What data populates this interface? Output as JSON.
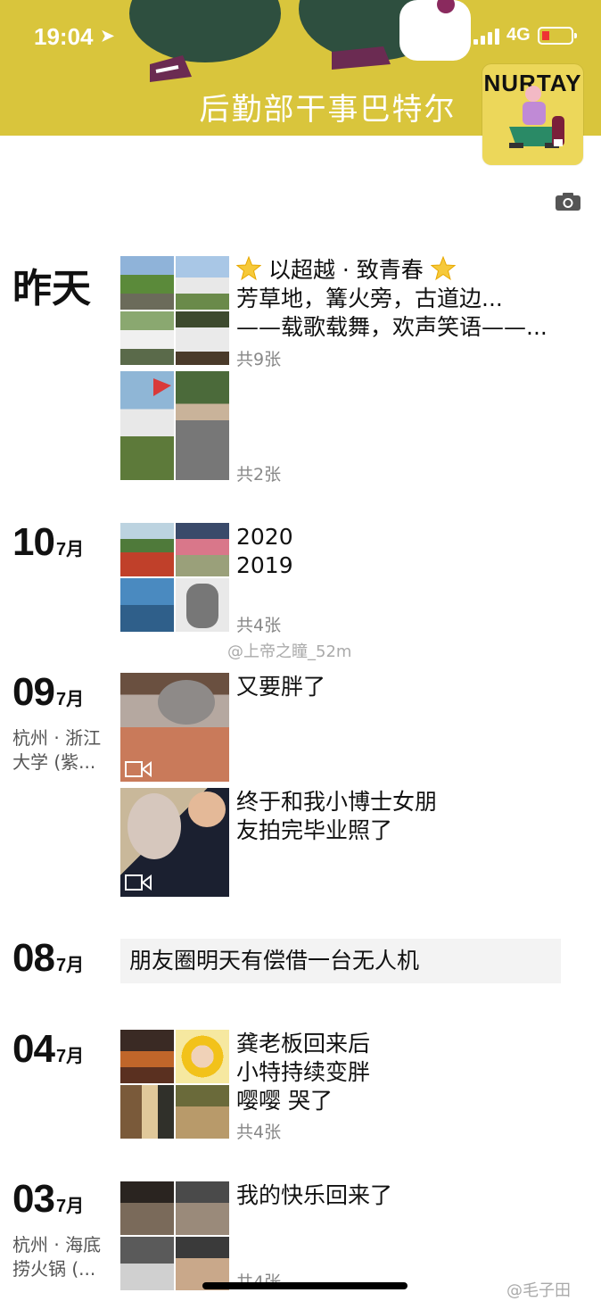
{
  "status_bar": {
    "time": "19:04",
    "location_symbol": "➤",
    "network": "4G"
  },
  "profile": {
    "name": "后勤部干事巴特尔",
    "avatar_text": "NURTAY"
  },
  "icons": {
    "camera": "camera-icon",
    "video": "video-icon",
    "star": "star-emoji-icon"
  },
  "posts": [
    {
      "day_label": "昨天",
      "lines": [
        "以超越 · 致青春",
        "芳草地，篝火旁，古道边...",
        "——载歌载舞，欢声笑语——..."
      ],
      "count": "共9张"
    },
    {
      "lines": [],
      "count": "共2张"
    },
    {
      "day": "10",
      "month": "7月",
      "lines": [
        "2020",
        "2019"
      ],
      "count": "共4张"
    },
    {
      "day": "09",
      "month": "7月",
      "place": [
        "杭州 · 浙江",
        "大学 (紫..."
      ],
      "lines": [
        "又要胖了"
      ]
    },
    {
      "lines": [
        "终于和我小博士女朋",
        "友拍完毕业照了"
      ]
    },
    {
      "day": "08",
      "month": "7月",
      "text_post": "朋友圈明天有偿借一台无人机"
    },
    {
      "day": "04",
      "month": "7月",
      "lines": [
        "龚老板回来后",
        "小特持续变胖",
        "嘤嘤 哭了"
      ],
      "count": "共4张"
    },
    {
      "day": "03",
      "month": "7月",
      "place": [
        "杭州 · 海底",
        "捞火锅 (..."
      ],
      "lines": [
        "我的快乐回来了"
      ],
      "count": "共4张"
    }
  ],
  "watermarks": {
    "mid": "@上帝之瞳_52m",
    "bottom": "@毛子田"
  }
}
